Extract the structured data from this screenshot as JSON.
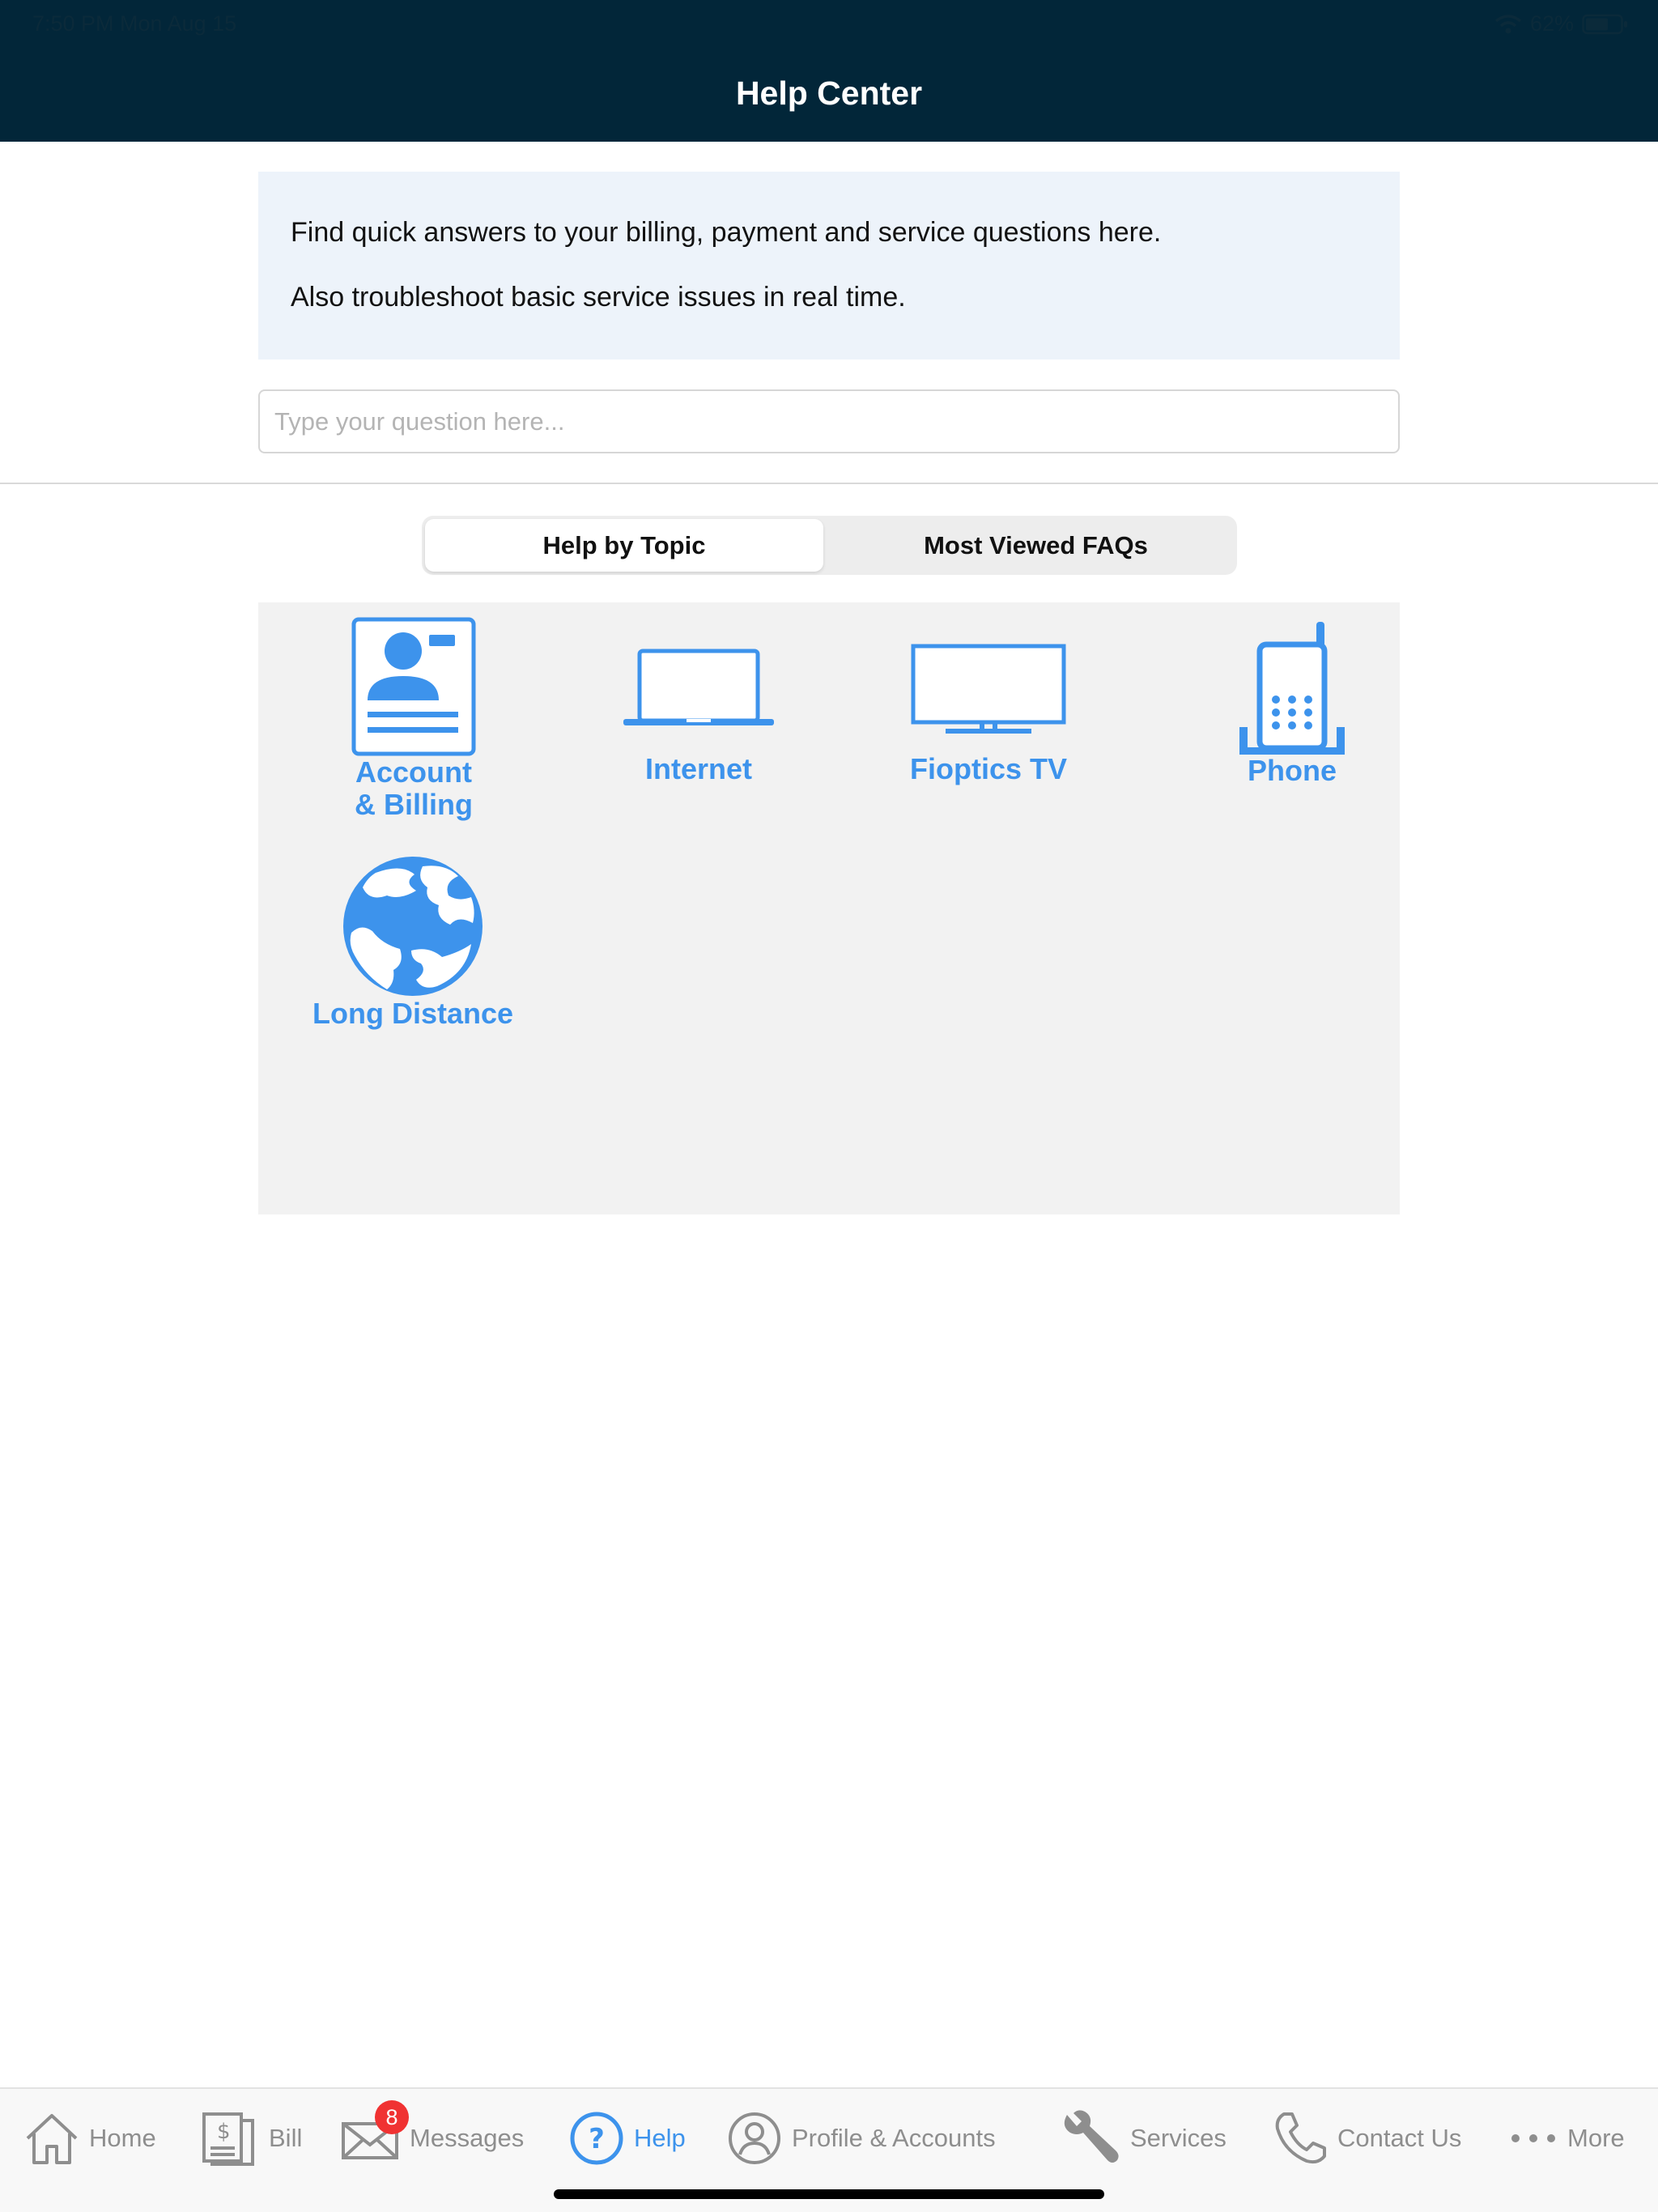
{
  "status_bar": {
    "time": "7:50 PM   Mon Aug 15",
    "battery": "62%"
  },
  "header": {
    "title": "Help Center"
  },
  "intro": {
    "line1": "Find quick answers to your billing, payment and service questions here.",
    "line2": "Also troubleshoot basic service issues in real time."
  },
  "search": {
    "placeholder": "Type your question here..."
  },
  "segments": {
    "active": "Help by Topic",
    "inactive": "Most Viewed FAQs"
  },
  "topics": [
    {
      "line1": "Account",
      "line2": "& Billing",
      "icon": "account-card-icon"
    },
    {
      "line1": "Internet",
      "icon": "laptop-icon"
    },
    {
      "line1": "Fioptics TV",
      "icon": "tv-icon"
    },
    {
      "line1": "Phone",
      "icon": "cordless-phone-icon"
    },
    {
      "line1": "Long Distance",
      "icon": "globe-icon"
    }
  ],
  "tabbar": {
    "home": "Home",
    "bill": "Bill",
    "messages": "Messages",
    "messages_badge": "8",
    "help": "Help",
    "profile": "Profile & Accounts",
    "services": "Services",
    "contact": "Contact Us",
    "more": "More"
  },
  "colors": {
    "header_bg": "#022639",
    "accent": "#3d93ec",
    "badge": "#f03232"
  }
}
